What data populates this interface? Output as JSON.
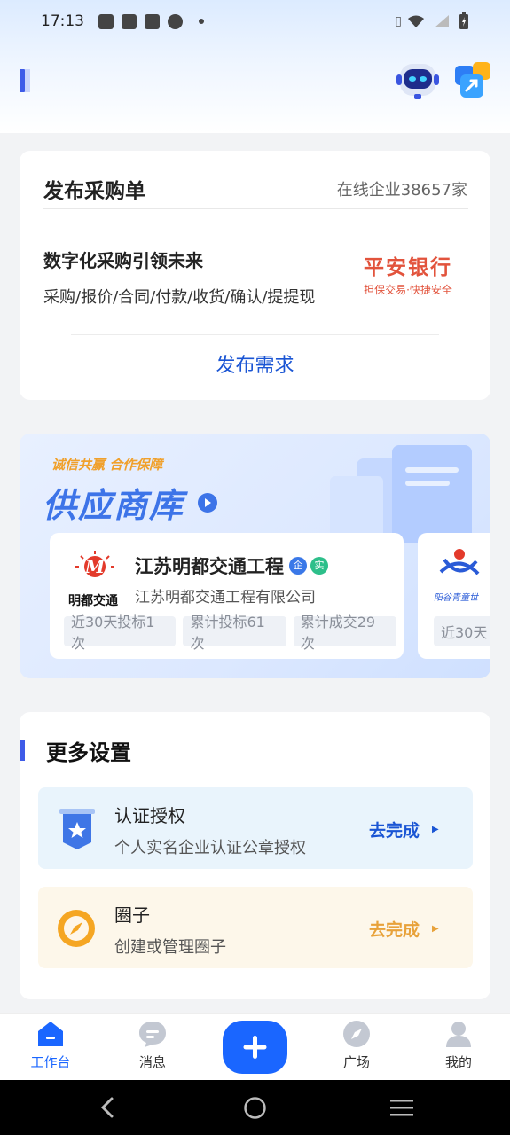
{
  "status": {
    "time": "17:13"
  },
  "purchase": {
    "title": "发布采购单",
    "online": "在线企业38657家",
    "headline": "数字化采购引领未来",
    "steps": "采购/报价/合同/付款/收货/确认/提提现",
    "bank_name": "平安银行",
    "bank_tagline": "担保交易·快捷安全",
    "publish_button": "发布需求"
  },
  "supplier": {
    "slogan": "诚信共赢 合作保障",
    "title": "供应商库",
    "card1": {
      "logo_text": "明都交通",
      "name": "江苏明都交通工程",
      "badge_ent": "企",
      "badge_real": "实",
      "full_name": "江苏明都交通工程有限公司",
      "tags": [
        "近30天投标1次",
        "累计投标61次",
        "累计成交29次"
      ]
    },
    "card2": {
      "logo_text": "阳谷青童世",
      "tag": "近30天"
    }
  },
  "settings": {
    "title": "更多设置",
    "items": [
      {
        "title": "认证授权",
        "desc": "个人实名企业认证公章授权",
        "action": "去完成"
      },
      {
        "title": "圈子",
        "desc": "创建或管理圈子",
        "action": "去完成"
      }
    ]
  },
  "nav": {
    "items": [
      "工作台",
      "消息",
      "广场",
      "我的"
    ]
  },
  "colors": {
    "accent": "#1a66ff",
    "orange": "#e8a23a",
    "bank_red": "#e2533c"
  }
}
